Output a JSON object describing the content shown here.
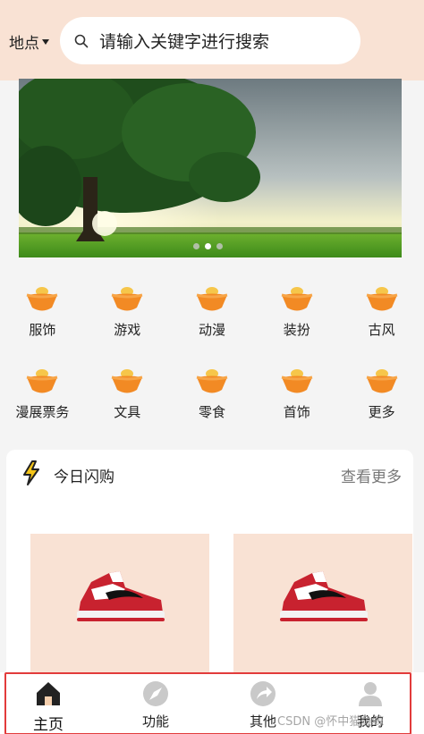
{
  "header": {
    "location_label": "地点",
    "search_placeholder": "请输入关键字进行搜索"
  },
  "banner": {
    "slides": 3,
    "active_slide": 1
  },
  "categories": [
    {
      "label": "服饰",
      "icon": "ingot-icon"
    },
    {
      "label": "游戏",
      "icon": "ingot-icon"
    },
    {
      "label": "动漫",
      "icon": "ingot-icon"
    },
    {
      "label": "装扮",
      "icon": "ingot-icon"
    },
    {
      "label": "古风",
      "icon": "ingot-icon"
    },
    {
      "label": "漫展票务",
      "icon": "ingot-icon"
    },
    {
      "label": "文具",
      "icon": "ingot-icon"
    },
    {
      "label": "零食",
      "icon": "ingot-icon"
    },
    {
      "label": "首饰",
      "icon": "ingot-icon"
    },
    {
      "label": "更多",
      "icon": "ingot-icon"
    }
  ],
  "flash_sale": {
    "title": "今日闪购",
    "more_label": "查看更多",
    "products": [
      {
        "image": "sneaker-image"
      },
      {
        "image": "sneaker-image"
      }
    ]
  },
  "tabbar": {
    "items": [
      {
        "label": "主页",
        "icon": "home-icon",
        "active": true
      },
      {
        "label": "功能",
        "icon": "compass-icon",
        "active": false
      },
      {
        "label": "其他",
        "icon": "share-arrow-icon",
        "active": false
      },
      {
        "label": "我的",
        "icon": "user-icon",
        "active": false
      }
    ]
  },
  "watermark": "CSDN @怀中猫鱼鲸",
  "colors": {
    "header_bg": "#f9e2d4",
    "accent_orange": "#f28a24",
    "tab_highlight": "#e23b3b"
  }
}
